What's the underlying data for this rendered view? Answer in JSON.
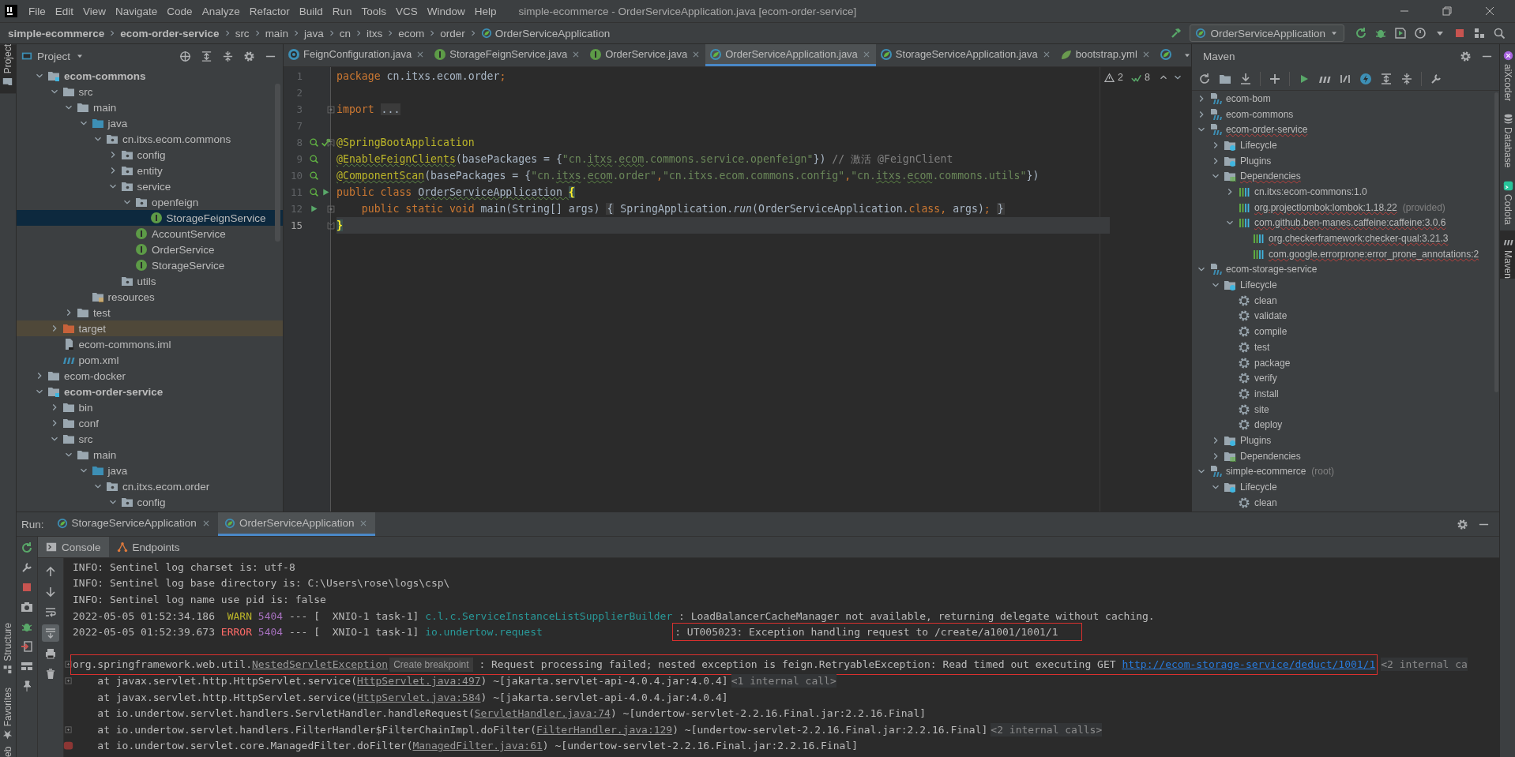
{
  "window": {
    "title": "simple-ecommerce - OrderServiceApplication.java [ecom-order-service]"
  },
  "menu": [
    "File",
    "Edit",
    "View",
    "Navigate",
    "Code",
    "Analyze",
    "Refactor",
    "Build",
    "Run",
    "Tools",
    "VCS",
    "Window",
    "Help"
  ],
  "navbar": {
    "breadcrumbs": [
      {
        "label": "simple-ecommerce",
        "kind": "project"
      },
      {
        "label": "ecom-order-service",
        "kind": "module"
      },
      {
        "label": "src",
        "kind": "folder"
      },
      {
        "label": "main",
        "kind": "folder"
      },
      {
        "label": "java",
        "kind": "folder"
      },
      {
        "label": "cn",
        "kind": "folder"
      },
      {
        "label": "itxs",
        "kind": "folder"
      },
      {
        "label": "ecom",
        "kind": "folder"
      },
      {
        "label": "order",
        "kind": "folder"
      },
      {
        "label": "OrderServiceApplication",
        "kind": "class"
      }
    ],
    "run_config": "OrderServiceApplication"
  },
  "stripes": {
    "left_top": [
      {
        "label": "Project",
        "selected": true
      }
    ],
    "left_bottom": [
      {
        "label": "Structure",
        "selected": false
      },
      {
        "label": "Favorites",
        "selected": false
      },
      {
        "label": "eb",
        "selected": false
      }
    ],
    "right": [
      {
        "label": "aiXcoder",
        "selected": false
      },
      {
        "label": "Database",
        "selected": false
      },
      {
        "label": "Codota",
        "selected": false
      },
      {
        "label": "Maven",
        "selected": true
      }
    ]
  },
  "project": {
    "title": "Project",
    "tree": [
      {
        "label": "ecom-commons",
        "kind": "module",
        "expanded": true,
        "selected": false,
        "children": [
          {
            "label": "src",
            "kind": "folder",
            "expanded": true,
            "selected": false,
            "children": [
              {
                "label": "main",
                "kind": "folder",
                "expanded": true,
                "selected": false,
                "children": [
                  {
                    "label": "java",
                    "kind": "source-folder",
                    "expanded": true,
                    "selected": false,
                    "children": [
                      {
                        "label": "cn.itxs.ecom.commons",
                        "kind": "package",
                        "expanded": true,
                        "selected": false,
                        "children": [
                          {
                            "label": "config",
                            "kind": "package",
                            "expanded": false,
                            "selected": false
                          },
                          {
                            "label": "entity",
                            "kind": "package",
                            "expanded": false,
                            "selected": false
                          },
                          {
                            "label": "service",
                            "kind": "package",
                            "expanded": true,
                            "selected": false,
                            "children": [
                              {
                                "label": "openfeign",
                                "kind": "package",
                                "expanded": true,
                                "selected": false,
                                "children": [
                                  {
                                    "label": "StorageFeignService",
                                    "kind": "interface",
                                    "selected": true
                                  }
                                ]
                              },
                              {
                                "label": "AccountService",
                                "kind": "interface",
                                "selected": false
                              },
                              {
                                "label": "OrderService",
                                "kind": "interface",
                                "selected": false
                              },
                              {
                                "label": "StorageService",
                                "kind": "interface",
                                "selected": false
                              }
                            ]
                          },
                          {
                            "label": "utils",
                            "kind": "package",
                            "selected": false
                          }
                        ]
                      }
                    ]
                  },
                  {
                    "label": "resources",
                    "kind": "resources-folder",
                    "selected": false
                  }
                ]
              },
              {
                "label": "test",
                "kind": "folder",
                "expanded": false,
                "selected": false
              }
            ]
          },
          {
            "label": "target",
            "kind": "excluded-folder",
            "expanded": false,
            "selected": false
          },
          {
            "label": "ecom-commons.iml",
            "kind": "iml-file",
            "selected": false
          },
          {
            "label": "pom.xml",
            "kind": "maven-file",
            "selected": false
          }
        ]
      },
      {
        "label": "ecom-docker",
        "kind": "folder",
        "expanded": false,
        "selected": false
      },
      {
        "label": "ecom-order-service",
        "kind": "module",
        "expanded": true,
        "selected": false,
        "children": [
          {
            "label": "bin",
            "kind": "folder",
            "expanded": false,
            "selected": false
          },
          {
            "label": "conf",
            "kind": "folder",
            "expanded": false,
            "selected": false
          },
          {
            "label": "src",
            "kind": "folder",
            "expanded": true,
            "selected": false,
            "children": [
              {
                "label": "main",
                "kind": "folder",
                "expanded": true,
                "selected": false,
                "children": [
                  {
                    "label": "java",
                    "kind": "source-folder",
                    "expanded": true,
                    "selected": false,
                    "children": [
                      {
                        "label": "cn.itxs.ecom.order",
                        "kind": "package",
                        "expanded": true,
                        "selected": false,
                        "children": [
                          {
                            "label": "config",
                            "kind": "package",
                            "expanded": true,
                            "selected": false
                          }
                        ]
                      }
                    ]
                  }
                ]
              }
            ]
          }
        ]
      }
    ]
  },
  "editor": {
    "tabs": [
      {
        "label": "FeignConfiguration.java",
        "kind": "class",
        "selected": false
      },
      {
        "label": "StorageFeignService.java",
        "kind": "interface",
        "selected": false
      },
      {
        "label": "OrderService.java",
        "kind": "interface",
        "selected": false
      },
      {
        "label": "OrderServiceApplication.java",
        "kind": "spring",
        "selected": true
      },
      {
        "label": "StorageServiceApplication.java",
        "kind": "spring",
        "selected": false
      },
      {
        "label": "bootstrap.yml",
        "kind": "yml",
        "selected": false
      },
      {
        "kind": "spring",
        "selected": false
      }
    ],
    "inspections": {
      "warnings": "2",
      "checks": "8"
    },
    "lines": [
      {
        "number": "1",
        "current": false,
        "tokens": [
          {
            "kind": "keyword",
            "text": "package"
          },
          {
            "kind": "plain",
            "text": " cn.itxs.ecom.order"
          },
          {
            "kind": "keyword",
            "text": ";"
          }
        ]
      },
      {
        "number": "2",
        "current": false
      },
      {
        "number": "3",
        "current": false,
        "fold": {
          "kind": "collapsed"
        },
        "tokens": [
          {
            "kind": "keyword",
            "text": "import "
          },
          {
            "kind": "folded",
            "text": "..."
          }
        ]
      },
      {
        "number": "7",
        "current": false
      },
      {
        "number": "8",
        "current": false,
        "fold": {
          "kind": "start"
        },
        "gutter": [
          {
            "kind": "bean"
          },
          {
            "kind": "bean-check"
          }
        ],
        "tokens": [
          {
            "kind": "annotation",
            "text": "@SpringBootApplication"
          }
        ]
      },
      {
        "number": "9",
        "current": false,
        "gutter": [
          {
            "kind": "bean"
          }
        ],
        "tokens": [
          {
            "kind": "annotation-typo",
            "text": "@EnableFeignClients"
          },
          {
            "kind": "plain",
            "text": "(basePackages = {"
          },
          {
            "kind": "string",
            "text": "\"cn."
          },
          {
            "kind": "string-typo",
            "text": "itxs"
          },
          {
            "kind": "string",
            "text": "."
          },
          {
            "kind": "string-typo",
            "text": "ecom"
          },
          {
            "kind": "string",
            "text": ".commons.service.openfeign\""
          },
          {
            "kind": "plain",
            "text": "}) "
          },
          {
            "kind": "comment",
            "text": "// 激活 @FeignClient"
          }
        ]
      },
      {
        "number": "10",
        "current": false,
        "gutter": [
          {
            "kind": "bean"
          }
        ],
        "tokens": [
          {
            "kind": "annotation-typo",
            "text": "@ComponentScan"
          },
          {
            "kind": "plain",
            "text": "(basePackages = {"
          },
          {
            "kind": "string",
            "text": "\"cn."
          },
          {
            "kind": "string-typo",
            "text": "itxs"
          },
          {
            "kind": "string",
            "text": "."
          },
          {
            "kind": "string-typo",
            "text": "ecom"
          },
          {
            "kind": "string",
            "text": ".order\""
          },
          {
            "kind": "keyword",
            "text": ","
          },
          {
            "kind": "string",
            "text": "\"cn.itxs.ecom.commons.config\""
          },
          {
            "kind": "keyword",
            "text": ","
          },
          {
            "kind": "string",
            "text": "\"cn."
          },
          {
            "kind": "string-typo",
            "text": "itxs"
          },
          {
            "kind": "string",
            "text": "."
          },
          {
            "kind": "string-typo",
            "text": "ecom"
          },
          {
            "kind": "string",
            "text": ".commons.utils\""
          },
          {
            "kind": "plain",
            "text": "})"
          }
        ]
      },
      {
        "number": "11",
        "current": false,
        "gutter": [
          {
            "kind": "bean"
          },
          {
            "kind": "run"
          }
        ],
        "tokens": [
          {
            "kind": "keyword",
            "text": "public class "
          },
          {
            "kind": "plain-typo",
            "text": "OrderServiceApplication "
          },
          {
            "kind": "brace-match",
            "text": "{"
          }
        ]
      },
      {
        "number": "12",
        "current": false,
        "fold": {
          "kind": "collapsed"
        },
        "gutter": [
          {
            "kind": "run"
          }
        ],
        "tokens": [
          {
            "kind": "keyword",
            "text": "    public static void"
          },
          {
            "kind": "plain",
            "text": " main(String[] args) "
          },
          {
            "kind": "folded",
            "text": "{"
          },
          {
            "kind": "plain",
            "text": " SpringApplication."
          },
          {
            "kind": "static-method",
            "text": "run"
          },
          {
            "kind": "plain",
            "text": "(OrderServiceApplication."
          },
          {
            "kind": "keyword",
            "text": "class"
          },
          {
            "kind": "keyword",
            "text": ","
          },
          {
            "kind": "plain",
            "text": " args)"
          },
          {
            "kind": "keyword",
            "text": "; "
          },
          {
            "kind": "folded",
            "text": "}"
          }
        ]
      },
      {
        "number": "15",
        "current": true,
        "fold": {
          "kind": "end"
        },
        "tokens": [
          {
            "kind": "brace-match",
            "text": "}"
          }
        ]
      }
    ]
  },
  "maven": {
    "title": "Maven",
    "tree": [
      {
        "label": "ecom-bom",
        "kind": "maven-module",
        "expanded": false,
        "error": false
      },
      {
        "label": "ecom-commons",
        "kind": "maven-module",
        "expanded": false,
        "error": false
      },
      {
        "label": "ecom-order-service",
        "kind": "maven-module",
        "expanded": true,
        "error": true,
        "children": [
          {
            "label": "Lifecycle",
            "kind": "lifecycle",
            "expanded": false,
            "error": false
          },
          {
            "label": "Plugins",
            "kind": "lifecycle",
            "expanded": false,
            "error": false
          },
          {
            "label": "Dependencies",
            "kind": "dependencies",
            "expanded": true,
            "error": true,
            "children": [
              {
                "label": "cn.itxs:ecom-commons:1.0",
                "kind": "dependency",
                "expanded": false,
                "error": false
              },
              {
                "label": "org.projectlombok:lombok:1.18.22",
                "note": "(provided)",
                "kind": "dependency",
                "error": true
              },
              {
                "label": "com.github.ben-manes.caffeine:caffeine:3.0.6",
                "kind": "dependency",
                "expanded": true,
                "error": true,
                "children": [
                  {
                    "label": "org.checkerframework:checker-qual:3.21.3",
                    "kind": "dependency",
                    "error": true
                  },
                  {
                    "label": "com.google.errorprone:error_prone_annotations:2",
                    "kind": "dependency",
                    "error": true
                  }
                ]
              }
            ]
          }
        ]
      },
      {
        "label": "ecom-storage-service",
        "kind": "maven-module",
        "expanded": true,
        "error": false,
        "children": [
          {
            "label": "Lifecycle",
            "kind": "lifecycle",
            "expanded": true,
            "error": false,
            "children": [
              {
                "label": "clean",
                "kind": "goal",
                "error": false
              },
              {
                "label": "validate",
                "kind": "goal",
                "error": false
              },
              {
                "label": "compile",
                "kind": "goal",
                "error": false
              },
              {
                "label": "test",
                "kind": "goal",
                "error": false
              },
              {
                "label": "package",
                "kind": "goal",
                "error": false
              },
              {
                "label": "verify",
                "kind": "goal",
                "error": false
              },
              {
                "label": "install",
                "kind": "goal",
                "error": false
              },
              {
                "label": "site",
                "kind": "goal",
                "error": false
              },
              {
                "label": "deploy",
                "kind": "goal",
                "error": false
              }
            ]
          },
          {
            "label": "Plugins",
            "kind": "lifecycle",
            "expanded": false,
            "error": false
          },
          {
            "label": "Dependencies",
            "kind": "dependencies",
            "expanded": false,
            "error": false
          }
        ]
      },
      {
        "label": "simple-ecommerce",
        "note": "(root)",
        "kind": "maven-module",
        "expanded": true,
        "error": false,
        "children": [
          {
            "label": "Lifecycle",
            "kind": "lifecycle",
            "expanded": true,
            "error": false,
            "children": [
              {
                "label": "clean",
                "kind": "goal",
                "error": false
              }
            ]
          }
        ]
      }
    ]
  },
  "run": {
    "label": "Run:",
    "tabs": [
      {
        "label": "StorageServiceApplication",
        "selected": false
      },
      {
        "label": "OrderServiceApplication",
        "selected": true
      }
    ],
    "console_tabs": [
      {
        "label": "Console",
        "kind": "console",
        "selected": true
      },
      {
        "label": "Endpoints",
        "kind": "endpoints",
        "selected": false
      }
    ],
    "toolbar": [
      {
        "kind": "up",
        "on": false
      },
      {
        "kind": "down",
        "on": false
      },
      {
        "kind": "wrap",
        "on": false
      },
      {
        "kind": "scroll-end",
        "on": true
      },
      {
        "kind": "print",
        "on": false
      },
      {
        "kind": "trash",
        "on": false
      }
    ],
    "lines": [
      {
        "kind": "log",
        "tokens": [
          {
            "kind": "text",
            "text": "INFO: Sentinel log charset is: utf-8"
          }
        ]
      },
      {
        "kind": "log",
        "tokens": [
          {
            "kind": "text",
            "text": "INFO: Sentinel log base directory is: C:\\Users\\rose\\logs\\csp\\"
          }
        ]
      },
      {
        "kind": "log",
        "tokens": [
          {
            "kind": "text",
            "text": "INFO: Sentinel log name use pid is: false"
          }
        ]
      },
      {
        "kind": "log",
        "tokens": [
          {
            "kind": "text",
            "text": "2022-05-05 01:52:34.186  "
          },
          {
            "kind": "warn",
            "text": "WARN"
          },
          {
            "kind": "pid",
            "text": " 5404"
          },
          {
            "kind": "text",
            "text": " --- [  XNIO-1 task-1] "
          },
          {
            "kind": "logger",
            "text": "c.l.c.ServiceInstanceListSupplierBuilder"
          },
          {
            "kind": "text",
            "text": " : LoadBalancerCacheManager not available, returning delegate without caching."
          }
        ]
      },
      {
        "kind": "log",
        "tokens": [
          {
            "kind": "text",
            "text": "2022-05-05 01:52:39.673 "
          },
          {
            "kind": "error",
            "text": "ERROR"
          },
          {
            "kind": "pid",
            "text": " 5404"
          },
          {
            "kind": "text",
            "text": " --- [  XNIO-1 task-1] "
          },
          {
            "kind": "logger",
            "text": "io.undertow.request"
          },
          {
            "kind": "box",
            "tokens": [
              {
                "kind": "text",
                "text": ": UT005023: Exception handling request to /create/a1001/1001/1"
              }
            ]
          }
        ]
      },
      {
        "kind": "blank"
      },
      {
        "kind": "log",
        "gutter": {
          "kind": "fold"
        },
        "tokens": [
          {
            "kind": "box",
            "tokens": [
              {
                "kind": "text",
                "text": "org.springframework.web.util."
              },
              {
                "kind": "class-link",
                "text": "NestedServletException"
              },
              {
                "kind": "hint",
                "text": "Create breakpoint"
              },
              {
                "kind": "text",
                "text": " : Request processing failed; nested exception is feign.RetryableException: Read timed out executing GET "
              },
              {
                "kind": "url",
                "text": "http://ecom-storage-service/deduct/1001/1"
              }
            ]
          },
          {
            "kind": "folded-calls",
            "text": "<2 internal ca"
          }
        ]
      },
      {
        "kind": "log",
        "gutter": {
          "kind": "fold"
        },
        "tokens": [
          {
            "kind": "text",
            "text": "    at javax.servlet.http.HttpServlet.service("
          },
          {
            "kind": "file-link",
            "text": "HttpServlet.java:497"
          },
          {
            "kind": "text",
            "text": ") ~[jakarta.servlet-api-4.0.4.jar:4.0.4]"
          },
          {
            "kind": "folded-calls",
            "text": "<1 internal call>"
          }
        ]
      },
      {
        "kind": "log",
        "tokens": [
          {
            "kind": "text",
            "text": "    at javax.servlet.http.HttpServlet.service("
          },
          {
            "kind": "file-link",
            "text": "HttpServlet.java:584"
          },
          {
            "kind": "text",
            "text": ") ~[jakarta.servlet-api-4.0.4.jar:4.0.4]"
          }
        ]
      },
      {
        "kind": "log",
        "tokens": [
          {
            "kind": "text",
            "text": "    at io.undertow.servlet.handlers.ServletHandler.handleRequest("
          },
          {
            "kind": "file-link",
            "text": "ServletHandler.java:74"
          },
          {
            "kind": "text",
            "text": ") ~[undertow-servlet-2.2.16.Final.jar:2.2.16.Final]"
          }
        ]
      },
      {
        "kind": "log",
        "gutter": {
          "kind": "fold"
        },
        "tokens": [
          {
            "kind": "text",
            "text": "    at io.undertow.servlet.handlers.FilterHandler$FilterChainImpl.doFilter("
          },
          {
            "kind": "file-link",
            "text": "FilterHandler.java:129"
          },
          {
            "kind": "text",
            "text": ") ~[undertow-servlet-2.2.16.Final.jar:2.2.16.Final]"
          },
          {
            "kind": "folded-calls",
            "text": "<2 internal calls>"
          }
        ]
      },
      {
        "kind": "log",
        "gutter": {
          "kind": "breakpoint"
        },
        "tokens": [
          {
            "kind": "text",
            "text": "    at io.undertow.servlet.core.ManagedFilter.doFilter("
          },
          {
            "kind": "file-link",
            "text": "ManagedFilter.java:61"
          },
          {
            "kind": "text",
            "text": ") ~[undertow-servlet-2.2.16.Final.jar:2.2.16.Final]"
          }
        ]
      }
    ]
  }
}
